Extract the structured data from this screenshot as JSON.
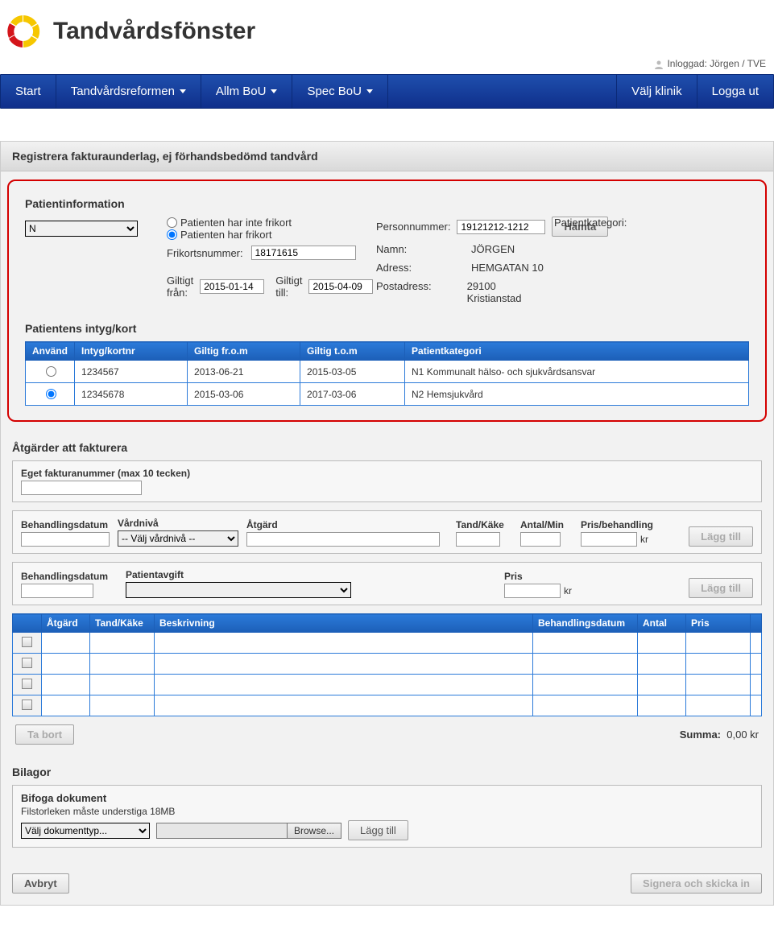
{
  "header": {
    "title": "Tandvårdsfönster",
    "logged_in_label": "Inloggad: Jörgen / TVE"
  },
  "nav": {
    "start": "Start",
    "reformen": "Tandvårdsreformen",
    "allm": "Allm BoU",
    "spec": "Spec BoU",
    "klinik": "Välj klinik",
    "logout": "Logga ut"
  },
  "panel_title": "Registrera fakturaunderlag, ej förhandsbedömd tandvård",
  "patient": {
    "section_title": "Patientinformation",
    "labels": {
      "personnummer": "Personnummer:",
      "hamta": "Hämta",
      "patientkategori": "Patientkategori:",
      "no_frikort": "Patienten har inte frikort",
      "has_frikort": "Patienten har frikort",
      "namn": "Namn:",
      "adress": "Adress:",
      "postadress": "Postadress:",
      "frikortsnummer": "Frikortsnummer:",
      "giltigt_fran": "Giltigt från:",
      "giltigt_till": "Giltigt till:"
    },
    "personnummer": "19121212-1212",
    "patientkategori": "N",
    "namn": "JÖRGEN",
    "adress": "HEMGATAN 10",
    "postadress": "29100 Kristianstad",
    "frikortsnummer": "18171615",
    "giltigt_fran": "2015-01-14",
    "giltigt_till": "2015-04-09",
    "frikort_selected": "has"
  },
  "intyg": {
    "section_title": "Patientens intyg/kort",
    "headers": {
      "anvand": "Använd",
      "nr": "Intyg/kortnr",
      "from": "Giltig fr.o.m",
      "tom": "Giltig t.o.m",
      "kat": "Patientkategori"
    },
    "rows": [
      {
        "nr": "1234567",
        "from": "2013-06-21",
        "tom": "2015-03-05",
        "kat": "N1 Kommunalt hälso- och sjukvårdsansvar",
        "selected": false
      },
      {
        "nr": "12345678",
        "from": "2015-03-06",
        "tom": "2017-03-06",
        "kat": "N2 Hemsjukvård",
        "selected": true
      }
    ]
  },
  "atg": {
    "section_title": "Åtgärder att fakturera",
    "faktnr_label": "Eget fakturanummer (max 10 tecken)",
    "row1": {
      "behandlingsdatum": "Behandlingsdatum",
      "vardniva": "Vårdnivå",
      "vardniva_placeholder": "-- Välj vårdnivå --",
      "atgard": "Åtgärd",
      "tandkake": "Tand/Käke",
      "antalmin": "Antal/Min",
      "pris": "Pris/behandling",
      "kr": "kr",
      "add": "Lägg till"
    },
    "row2": {
      "behandlingsdatum": "Behandlingsdatum",
      "patientavgift": "Patientavgift",
      "pris": "Pris",
      "kr": "kr",
      "add": "Lägg till"
    },
    "table_headers": {
      "atgard": "Åtgärd",
      "tandkake": "Tand/Käke",
      "beskrivning": "Beskrivning",
      "behandlingsdatum": "Behandlingsdatum",
      "antal": "Antal",
      "pris": "Pris"
    },
    "remove": "Ta bort",
    "summa_label": "Summa:",
    "summa_value": "0,00 kr"
  },
  "bilagor": {
    "section_title": "Bilagor",
    "bifoga": "Bifoga dokument",
    "size_note": "Filstorleken måste understiga 18MB",
    "doc_type_placeholder": "Välj dokumenttyp...",
    "browse": "Browse...",
    "add": "Lägg till"
  },
  "footer": {
    "avbryt": "Avbryt",
    "signera": "Signera och skicka in"
  }
}
